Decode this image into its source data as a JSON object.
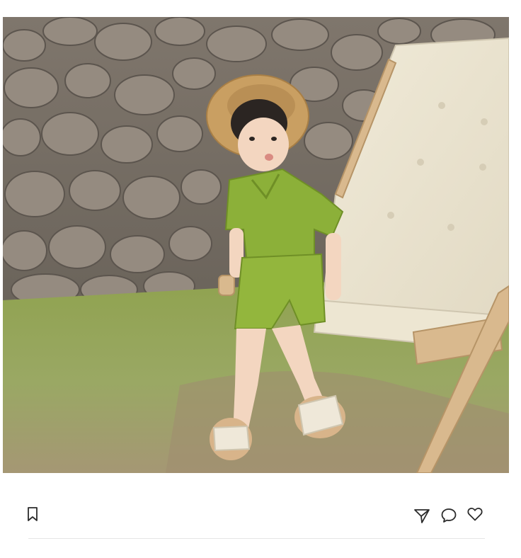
{
  "post": {
    "image": {
      "subject": "photo"
    }
  },
  "actions": {
    "bookmark_icon": "bookmark-icon",
    "share_icon": "send-icon",
    "comment_icon": "comment-icon",
    "like_icon": "heart-icon"
  },
  "colors": {
    "icon_stroke": "#2b2b2b",
    "divider": "#e6e6e6"
  }
}
